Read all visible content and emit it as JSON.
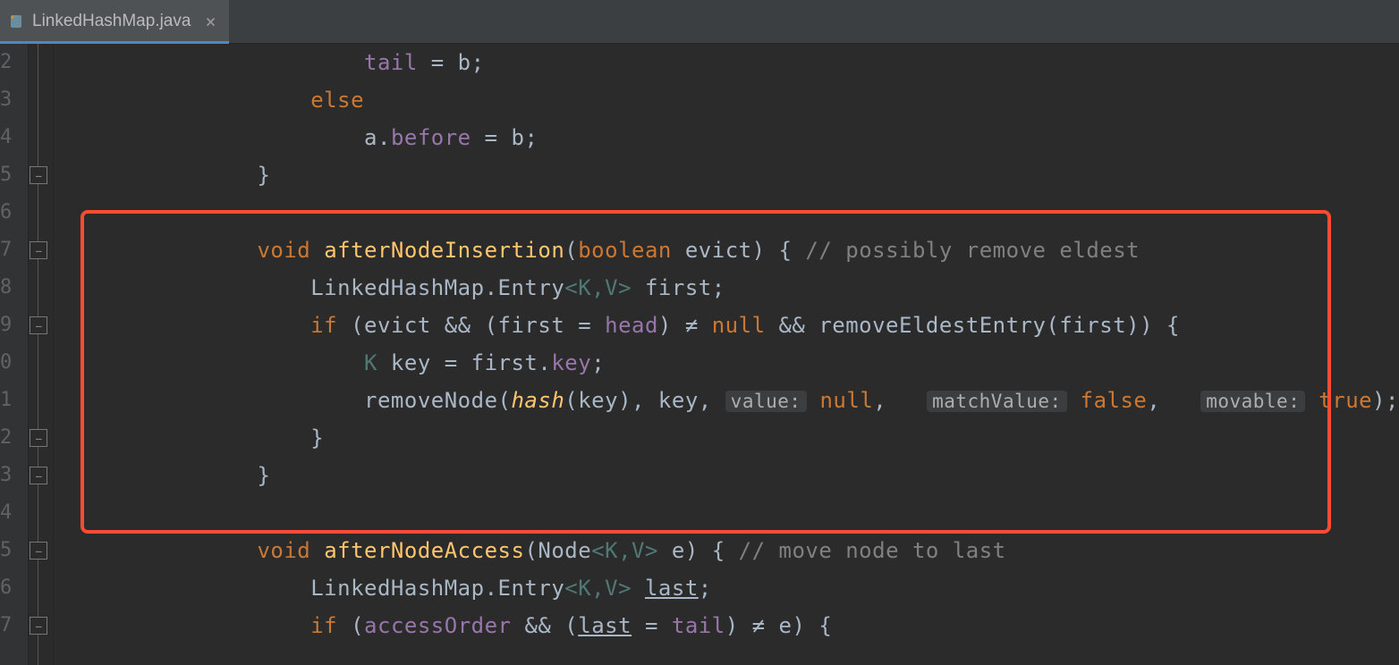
{
  "tab": {
    "filename": "LinkedHashMap.java",
    "close_glyph": "×"
  },
  "gutter": {
    "lines": [
      "2",
      "3",
      "4",
      "5",
      "6",
      "7",
      "8",
      "9",
      "0",
      "1",
      "2",
      "3",
      "4",
      "5",
      "6",
      "7"
    ]
  },
  "code": {
    "indent2": "        ",
    "indent3": "            ",
    "indent4": "                ",
    "indent5": "                    ",
    "l1_tail": "tail",
    "l1_eq_b": " = b;",
    "l2_else": "else",
    "l3_a_dot": "a.",
    "l3_before": "before",
    "l3_eq_b": " = b;",
    "l4_brace": "}",
    "l6_void": "void",
    "l6_fn": "afterNodeInsertion",
    "l6_open": "(",
    "l6_bool": "boolean",
    "l6_param": " evict) { ",
    "l6_cmt": "// possibly remove eldest",
    "l7_lhm": "LinkedHashMap.Entry",
    "l7_kv": "<K,V>",
    "l7_first": " first;",
    "l8_if": "if",
    "l8_open": " (evict && (first = ",
    "l8_head": "head",
    "l8_ne": ") ≠ ",
    "l8_null": "null",
    "l8_rest": " && removeEldestEntry(first)) {",
    "l9_K": "K",
    "l9_key_eq": " key = first.",
    "l9_key": "key",
    "l9_semi": ";",
    "l10_remove": "removeNode(",
    "l10_hash": "hash",
    "l10_hash_args": "(key), key, ",
    "l10_h1": "value:",
    "l10_null": "null",
    "l10_c1": ", ",
    "l10_h2": "matchValue:",
    "l10_false": "false",
    "l10_c2": ", ",
    "l10_h3": "movable:",
    "l10_true": "true",
    "l10_end": ");",
    "l11_brace": "}",
    "l12_brace": "}",
    "l14_void": "void",
    "l14_fn": "afterNodeAccess",
    "l14_open": "(Node",
    "l14_kv": "<K,V>",
    "l14_e": " e) { ",
    "l14_cmt": "// move node to last",
    "l15_lhm": "LinkedHashMap.Entry",
    "l15_kv": "<K,V>",
    "l15_sp": " ",
    "l15_last": "last",
    "l15_semi": ";",
    "l16_if": "if",
    "l16_open": " (",
    "l16_access": "accessOrder",
    "l16_and": " && (",
    "l16_last": "last",
    "l16_eq": " = ",
    "l16_tail": "tail",
    "l16_ne": ") ≠ e) {"
  }
}
